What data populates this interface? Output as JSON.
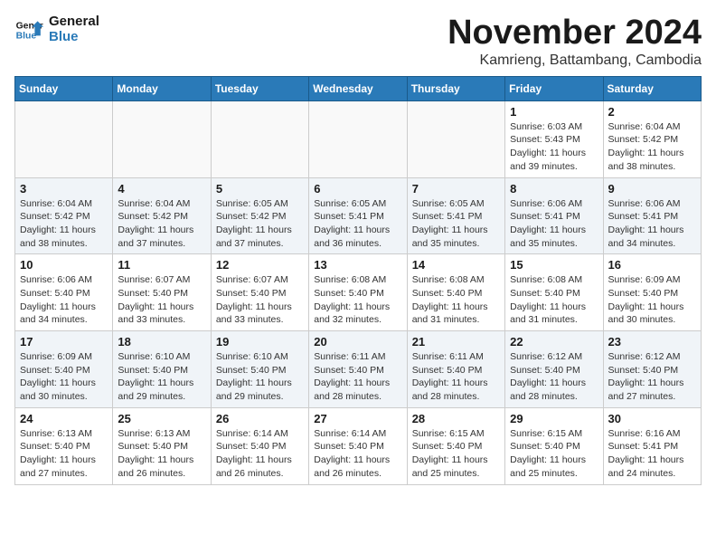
{
  "logo": {
    "line1": "General",
    "line2": "Blue"
  },
  "title": "November 2024",
  "location": "Kamrieng, Battambang, Cambodia",
  "weekdays": [
    "Sunday",
    "Monday",
    "Tuesday",
    "Wednesday",
    "Thursday",
    "Friday",
    "Saturday"
  ],
  "weeks": [
    [
      {
        "day": "",
        "info": ""
      },
      {
        "day": "",
        "info": ""
      },
      {
        "day": "",
        "info": ""
      },
      {
        "day": "",
        "info": ""
      },
      {
        "day": "",
        "info": ""
      },
      {
        "day": "1",
        "info": "Sunrise: 6:03 AM\nSunset: 5:43 PM\nDaylight: 11 hours and 39 minutes."
      },
      {
        "day": "2",
        "info": "Sunrise: 6:04 AM\nSunset: 5:42 PM\nDaylight: 11 hours and 38 minutes."
      }
    ],
    [
      {
        "day": "3",
        "info": "Sunrise: 6:04 AM\nSunset: 5:42 PM\nDaylight: 11 hours and 38 minutes."
      },
      {
        "day": "4",
        "info": "Sunrise: 6:04 AM\nSunset: 5:42 PM\nDaylight: 11 hours and 37 minutes."
      },
      {
        "day": "5",
        "info": "Sunrise: 6:05 AM\nSunset: 5:42 PM\nDaylight: 11 hours and 37 minutes."
      },
      {
        "day": "6",
        "info": "Sunrise: 6:05 AM\nSunset: 5:41 PM\nDaylight: 11 hours and 36 minutes."
      },
      {
        "day": "7",
        "info": "Sunrise: 6:05 AM\nSunset: 5:41 PM\nDaylight: 11 hours and 35 minutes."
      },
      {
        "day": "8",
        "info": "Sunrise: 6:06 AM\nSunset: 5:41 PM\nDaylight: 11 hours and 35 minutes."
      },
      {
        "day": "9",
        "info": "Sunrise: 6:06 AM\nSunset: 5:41 PM\nDaylight: 11 hours and 34 minutes."
      }
    ],
    [
      {
        "day": "10",
        "info": "Sunrise: 6:06 AM\nSunset: 5:40 PM\nDaylight: 11 hours and 34 minutes."
      },
      {
        "day": "11",
        "info": "Sunrise: 6:07 AM\nSunset: 5:40 PM\nDaylight: 11 hours and 33 minutes."
      },
      {
        "day": "12",
        "info": "Sunrise: 6:07 AM\nSunset: 5:40 PM\nDaylight: 11 hours and 33 minutes."
      },
      {
        "day": "13",
        "info": "Sunrise: 6:08 AM\nSunset: 5:40 PM\nDaylight: 11 hours and 32 minutes."
      },
      {
        "day": "14",
        "info": "Sunrise: 6:08 AM\nSunset: 5:40 PM\nDaylight: 11 hours and 31 minutes."
      },
      {
        "day": "15",
        "info": "Sunrise: 6:08 AM\nSunset: 5:40 PM\nDaylight: 11 hours and 31 minutes."
      },
      {
        "day": "16",
        "info": "Sunrise: 6:09 AM\nSunset: 5:40 PM\nDaylight: 11 hours and 30 minutes."
      }
    ],
    [
      {
        "day": "17",
        "info": "Sunrise: 6:09 AM\nSunset: 5:40 PM\nDaylight: 11 hours and 30 minutes."
      },
      {
        "day": "18",
        "info": "Sunrise: 6:10 AM\nSunset: 5:40 PM\nDaylight: 11 hours and 29 minutes."
      },
      {
        "day": "19",
        "info": "Sunrise: 6:10 AM\nSunset: 5:40 PM\nDaylight: 11 hours and 29 minutes."
      },
      {
        "day": "20",
        "info": "Sunrise: 6:11 AM\nSunset: 5:40 PM\nDaylight: 11 hours and 28 minutes."
      },
      {
        "day": "21",
        "info": "Sunrise: 6:11 AM\nSunset: 5:40 PM\nDaylight: 11 hours and 28 minutes."
      },
      {
        "day": "22",
        "info": "Sunrise: 6:12 AM\nSunset: 5:40 PM\nDaylight: 11 hours and 28 minutes."
      },
      {
        "day": "23",
        "info": "Sunrise: 6:12 AM\nSunset: 5:40 PM\nDaylight: 11 hours and 27 minutes."
      }
    ],
    [
      {
        "day": "24",
        "info": "Sunrise: 6:13 AM\nSunset: 5:40 PM\nDaylight: 11 hours and 27 minutes."
      },
      {
        "day": "25",
        "info": "Sunrise: 6:13 AM\nSunset: 5:40 PM\nDaylight: 11 hours and 26 minutes."
      },
      {
        "day": "26",
        "info": "Sunrise: 6:14 AM\nSunset: 5:40 PM\nDaylight: 11 hours and 26 minutes."
      },
      {
        "day": "27",
        "info": "Sunrise: 6:14 AM\nSunset: 5:40 PM\nDaylight: 11 hours and 26 minutes."
      },
      {
        "day": "28",
        "info": "Sunrise: 6:15 AM\nSunset: 5:40 PM\nDaylight: 11 hours and 25 minutes."
      },
      {
        "day": "29",
        "info": "Sunrise: 6:15 AM\nSunset: 5:40 PM\nDaylight: 11 hours and 25 minutes."
      },
      {
        "day": "30",
        "info": "Sunrise: 6:16 AM\nSunset: 5:41 PM\nDaylight: 11 hours and 24 minutes."
      }
    ]
  ]
}
